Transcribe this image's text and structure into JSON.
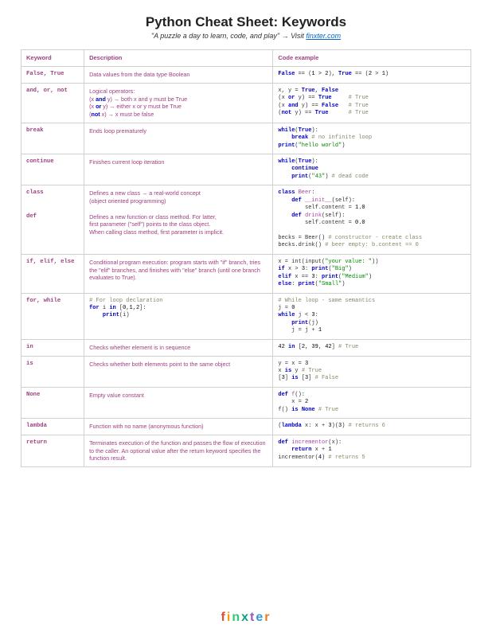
{
  "title": "Python Cheat Sheet: Keywords",
  "subtitle_pre": "\"A puzzle a day to learn, code, and play\" → Visit ",
  "subtitle_link": "finxter.com",
  "headers": {
    "c1": "Keyword",
    "c2": "Description",
    "c3": "Code example"
  },
  "rows": [
    {
      "keyword": "False, True",
      "desc_plain": "Data values from the data type Boolean",
      "code_html": "<span class='c-kw'>False</span> == (<span class='c-num'>1</span> > <span class='c-num'>2</span>), <span class='c-kw'>True</span> == (<span class='c-num'>2</span> > <span class='c-num'>1</span>)"
    },
    {
      "keyword": "and, or, not",
      "desc_html": "Logical operators:<br>(x <span class='c-kw'>and</span> y) → both x and y must be True<br>(x <span class='c-kw'>or</span> y) → either x or y must be True<br>(<span class='c-kw'>not</span> x) → x must be false",
      "code_html": "x, y = <span class='c-kw'>True</span>, <span class='c-kw'>False</span>\n(x <span class='c-kw'>or</span> y) == <span class='c-kw'>True</span>     <span class='c-cmt'># True</span>\n(x <span class='c-kw'>and</span> y) == <span class='c-kw'>False</span>   <span class='c-cmt'># True</span>\n(<span class='c-kw'>not</span> y) == <span class='c-kw'>True</span>      <span class='c-cmt'># True</span>"
    },
    {
      "keyword": "break",
      "desc_plain": "Ends loop prematurely",
      "code_html": "<span class='c-kw'>while</span>(<span class='c-kw'>True</span>):\n    <span class='c-kw'>break</span> <span class='c-cmt'># no infinite loop</span>\n<span class='c-kw'>print</span>(<span class='c-str'>\"hello world\"</span>)"
    },
    {
      "keyword": "continue",
      "desc_plain": "Finishes current loop iteration",
      "code_html": "<span class='c-kw'>while</span>(<span class='c-kw'>True</span>):\n    <span class='c-kw'>continue</span>\n    <span class='c-kw'>print</span>(<span class='c-str'>\"43\"</span>) <span class='c-cmt'># dead code</span>"
    },
    {
      "keyword": "class\n\n\ndef",
      "desc_html": "Defines a new class → a real-world concept<br>(object oriented programming)<br><br>Defines a new function or class method. For latter,<br>first parameter (\"self\") points to the class object.<br>When calling class method, first parameter is implicit.",
      "code_html": "<span class='c-kw'>class</span> <span class='c-def'>Beer</span>:\n    <span class='c-kw'>def</span> <span class='c-def'>__init__</span>(self):\n        self.content = <span class='c-num'>1.0</span>\n    <span class='c-kw'>def</span> <span class='c-def'>drink</span>(self):\n        self.content = <span class='c-num'>0.0</span>\n\nbecks = Beer() <span class='c-cmt'># constructor - create class</span>\nbecks.drink() <span class='c-cmt'># beer empty: b.content == 0</span>"
    },
    {
      "keyword": "if, elif, else",
      "desc_plain": "Conditional program execution: program starts with \"if\" branch, tries the \"elif\" branches, and finishes with \"else\" branch (until one branch evaluates to True).",
      "code_html": "x = int(input(<span class='c-str'>\"your value: \"</span>))\n<span class='c-kw'>if</span> x > <span class='c-num'>3</span>: <span class='c-kw'>print</span>(<span class='c-str'>\"Big\"</span>)\n<span class='c-kw'>elif</span> x == <span class='c-num'>3</span>: <span class='c-kw'>print</span>(<span class='c-str'>\"Medium\"</span>)\n<span class='c-kw'>else</span>: <span class='c-kw'>print</span>(<span class='c-str'>\"Small\"</span>)"
    },
    {
      "keyword": "for, while",
      "desc_code_html": "<span class='c-cmt'># For loop declaration</span>\n<span class='c-kw'>for</span> i <span class='c-kw'>in</span> [<span class='c-num'>0</span>,<span class='c-num'>1</span>,<span class='c-num'>2</span>]:\n    <span class='c-kw'>print</span>(i)",
      "code_html": "<span class='c-cmt'># While loop - same semantics</span>\nj = <span class='c-num'>0</span>\n<span class='c-kw'>while</span> j < <span class='c-num'>3</span>:\n    <span class='c-kw'>print</span>(j)\n    j = j + <span class='c-num'>1</span>"
    },
    {
      "keyword": "in",
      "desc_plain": "Checks whether element is in sequence",
      "code_html": "<span class='c-num'>42</span> <span class='c-kw'>in</span> [<span class='c-num'>2</span>, <span class='c-num'>39</span>, <span class='c-num'>42</span>] <span class='c-cmt'># True</span>"
    },
    {
      "keyword": "is",
      "desc_plain": "Checks whether both elements point to the same object",
      "code_html": "y = x = <span class='c-num'>3</span>\nx <span class='c-kw'>is</span> y <span class='c-cmt'># True</span>\n[<span class='c-num'>3</span>] <span class='c-kw'>is</span> [<span class='c-num'>3</span>] <span class='c-cmt'># False</span>"
    },
    {
      "keyword": "None",
      "desc_plain": "Empty value constant",
      "code_html": "<span class='c-kw'>def</span> <span class='c-def'>f</span>():\n    x = <span class='c-num'>2</span>\nf() <span class='c-kw'>is</span> <span class='c-kw'>None</span> <span class='c-cmt'># True</span>"
    },
    {
      "keyword": "lambda",
      "desc_plain": "Function with no name (anonymous function)",
      "code_html": "(<span class='c-kw'>lambda</span> x: x + <span class='c-num'>3</span>)(<span class='c-num'>3</span>) <span class='c-cmt'># returns 6</span>"
    },
    {
      "keyword": "return",
      "desc_plain": "Terminates execution of the function and passes the flow of execution to the caller. An optional value after the return keyword specifies the function result.",
      "code_html": "<span class='c-kw'>def</span> <span class='c-def'>incrementor</span>(x):\n    <span class='c-kw'>return</span> x + <span class='c-num'>1</span>\nincrementor(<span class='c-num'>4</span>) <span class='c-cmt'># returns 5</span>"
    }
  ],
  "footer": "finxter"
}
